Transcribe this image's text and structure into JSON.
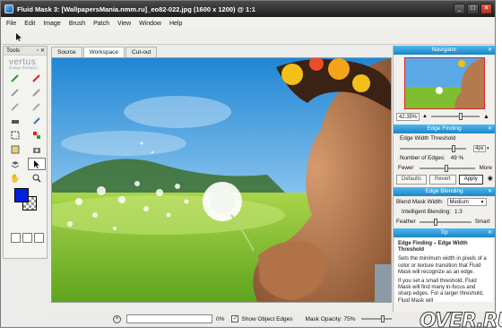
{
  "window": {
    "title": "Fluid Mask 3: [WallpapersMania.nmm.ru]_eo82-022.jpg (1600 x 1200) @ 1:1",
    "controls": [
      "_",
      "□",
      "✕"
    ]
  },
  "menu": [
    "File",
    "Edit",
    "Image",
    "Brush",
    "Patch",
    "View",
    "Window",
    "Help"
  ],
  "tools_panel": {
    "title": "Tools",
    "logo": "vertus",
    "logo_sub": "[image therapy]",
    "tools": [
      "brush-green-icon",
      "brush-red-icon",
      "brush-gray-1-icon",
      "brush-gray-2-icon",
      "brush-gray-3-icon",
      "brush-gray-4-icon",
      "eraser-icon",
      "eyedropper-icon",
      "marquee-select-icon",
      "color-picker-icon",
      "patch-icon",
      "camera-icon",
      "layers-icon",
      "pointer-icon",
      "hand-icon",
      "zoom-icon"
    ]
  },
  "doc_tabs": [
    "Source",
    "Workspace",
    "Cut-out"
  ],
  "active_tab": "Workspace",
  "navigator": {
    "title": "Navigator",
    "zoom": "42.35%",
    "zoom_level": 0.62
  },
  "edge_finding": {
    "title": "Edge Finding",
    "threshold_label": "Edge Width Threshold",
    "threshold_value": "4px",
    "threshold_level": 0.83,
    "edges_label": "Number of Edges:",
    "edges_value": "49 %",
    "edges_level": 0.49,
    "fewer": "Fewer",
    "more": "More",
    "buttons": [
      "Defaults",
      "Revert",
      "Apply"
    ]
  },
  "edge_blending": {
    "title": "Edge Blending",
    "width_label": "Blend Mask Width:",
    "width_value": "Medium",
    "intelligent_label": "Intelligent Blending:",
    "intelligent_value": "1:3",
    "feather": "Feather",
    "smart": "Smart",
    "blend_level": 0.3
  },
  "tip": {
    "title": "Tip",
    "heading": "Edge Finding – Edge Width Threshold",
    "p1": "Sets the minimum width in pixels of a color or texture transition that Fluid Mask will recognize as an edge.",
    "p2": "If you set a small threshold, Fluid Mask will find many in-focus and sharp edges. For a larger threshold, Fluid Mask will"
  },
  "status": {
    "progress_pct": "0%",
    "progress_level": 0,
    "show_edges_label": "Show Object Edges",
    "show_edges_checked": "✓",
    "opacity_label": "Mask Opacity: 75%",
    "opacity_level": 0.75
  },
  "watermark": "OVER.RU",
  "colors": {
    "accent": "#2a95d8",
    "foreground_swatch": "#0020e0"
  }
}
